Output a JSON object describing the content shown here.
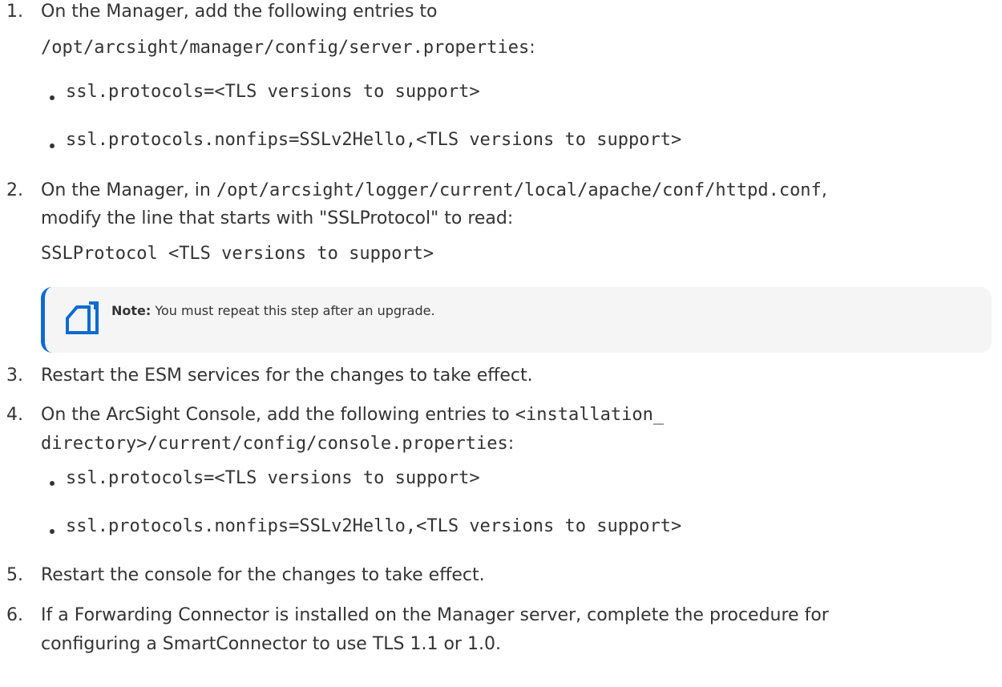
{
  "steps": [
    {
      "num": "1.",
      "text_before": "On the Manager, add the following entries to",
      "path": "/opt/arcsight/manager/config/server.properties",
      "path_suffix": ":",
      "bullets": [
        "ssl.protocols=<TLS versions to support>",
        "ssl.protocols.nonfips=SSLv2Hello,<TLS versions to support>"
      ]
    },
    {
      "num": "2.",
      "prefix": "On the Manager, in ",
      "path": "/opt/arcsight/logger/current/local/apache/conf/httpd.conf",
      "path_suffix": ",",
      "line2": "modify the line that starts with \"SSLProtocol\" to read:",
      "code": "SSLProtocol <TLS versions to support>"
    },
    {
      "num": "3.",
      "text": "Restart the ESM services for the changes to take effect."
    },
    {
      "num": "4.",
      "prefix": "On the ArcSight Console, add the following entries to ",
      "path_part1": "<installation_",
      "path_part2": "directory>/current/config/console.properties",
      "path_suffix": ":",
      "bullets": [
        "ssl.protocols=<TLS versions to support>",
        "ssl.protocols.nonfips=SSLv2Hello,<TLS versions to support>"
      ]
    },
    {
      "num": "5.",
      "text": "Restart the console for the changes to take effect."
    },
    {
      "num": "6.",
      "line1": "If a Forwarding Connector is installed on the Manager server, complete the procedure for",
      "line2": "configuring a SmartConnector to use TLS 1.1 or 1.0."
    }
  ],
  "note": {
    "icon": "note-icon",
    "label": "Note:",
    "text": " You must repeat this step after an upgrade."
  },
  "colors": {
    "accent": "#0a6bd1",
    "text": "#333333",
    "note_bg": "#f5f5f5"
  }
}
